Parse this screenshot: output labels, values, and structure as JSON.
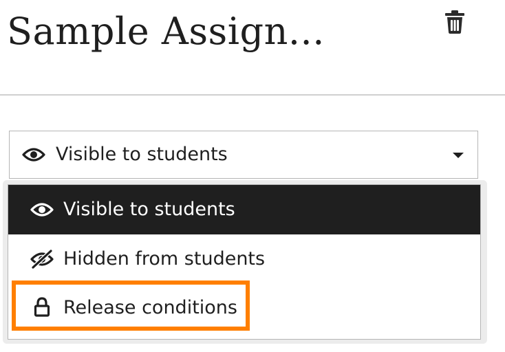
{
  "header": {
    "title": "Sample Assign..."
  },
  "visibility_select": {
    "selected_label": "Visible to students",
    "selected_icon": "eye-icon"
  },
  "menu": {
    "options": [
      {
        "label": "Visible to students",
        "icon": "eye-icon",
        "selected": true
      },
      {
        "label": "Hidden from students",
        "icon": "eye-slash-icon",
        "selected": false
      },
      {
        "label": "Release conditions",
        "icon": "lock-icon",
        "selected": false
      }
    ]
  },
  "colors": {
    "text": "#1f1f1f",
    "selected_bg": "#1f1f1f",
    "selected_text": "#ffffff",
    "highlight": "#ff7f00",
    "border": "#b5b5b5",
    "divider": "#cfcfcf"
  }
}
